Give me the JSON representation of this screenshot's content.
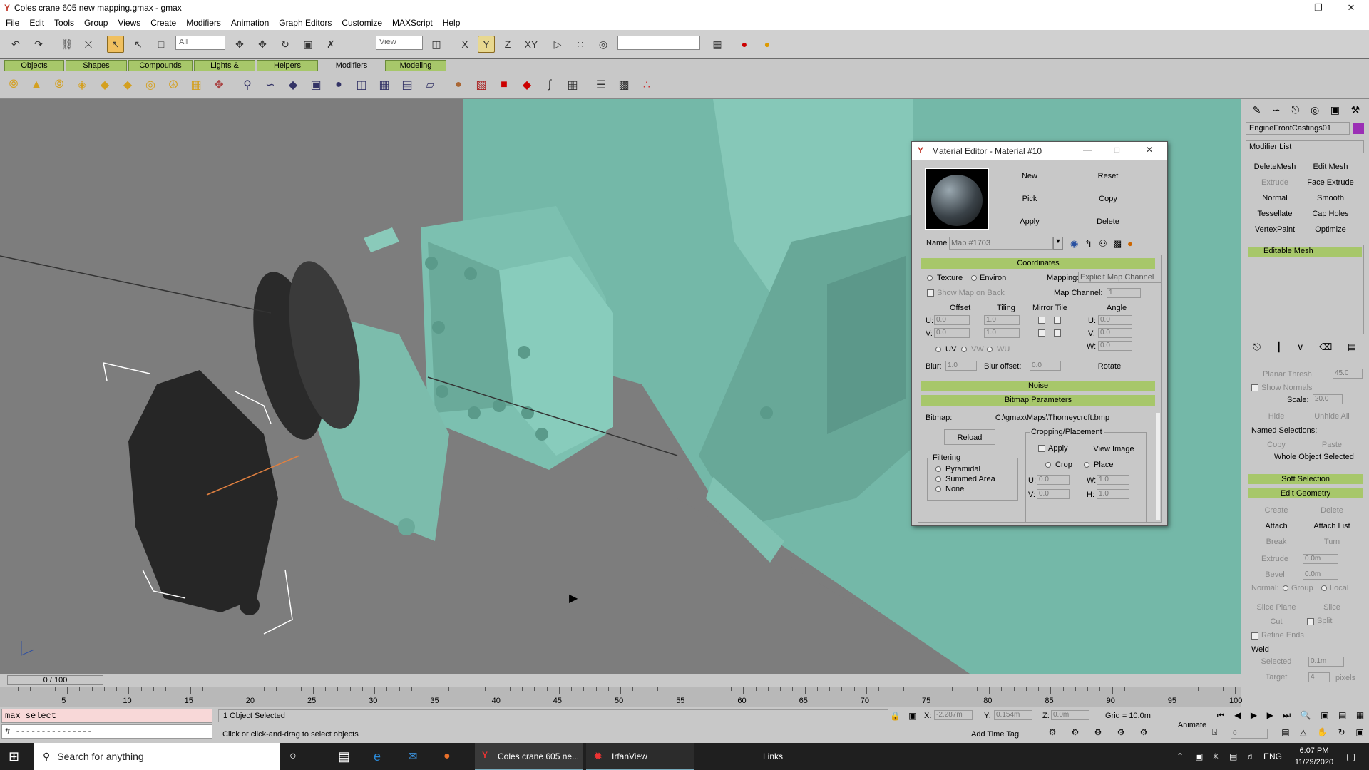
{
  "window": {
    "title": "Coles crane 605 new mapping.gmax - gmax"
  },
  "menu": [
    "File",
    "Edit",
    "Tools",
    "Group",
    "Views",
    "Create",
    "Modifiers",
    "Animation",
    "Graph Editors",
    "Customize",
    "MAXScript",
    "Help"
  ],
  "toolbar": {
    "selection_filter": "All",
    "ref_coord": "View",
    "axis_labels": [
      "X",
      "Y",
      "Z",
      "XY"
    ]
  },
  "tabs": [
    "Objects",
    "Shapes",
    "Compounds",
    "Lights & Cameras",
    "Helpers",
    "Modifiers",
    "Modeling"
  ],
  "active_tab": "Modifiers",
  "material_editor": {
    "title": "Material Editor - Material #10",
    "buttons": {
      "new": "New",
      "reset": "Reset",
      "pick": "Pick",
      "copy": "Copy",
      "apply": "Apply",
      "delete": "Delete"
    },
    "name_label": "Name",
    "name_value": "Map #1703",
    "coordinates": {
      "header": "Coordinates",
      "texture": "Texture",
      "environ": "Environ",
      "mapping_label": "Mapping:",
      "mapping_value": "Explicit Map Channel",
      "show_map_on_back": "Show Map on Back",
      "map_channel_label": "Map Channel:",
      "map_channel_value": "1",
      "offset": "Offset",
      "tiling": "Tiling",
      "mirror_tile": "Mirror Tile",
      "angle": "Angle",
      "u": "U:",
      "v": "V:",
      "w": "W:",
      "offset_u": "0.0",
      "offset_v": "0.0",
      "tiling_u": "1.0",
      "tiling_v": "1.0",
      "angle_u": "0.0",
      "angle_v": "0.0",
      "angle_w": "0.0",
      "uv": "UV",
      "vw": "VW",
      "wu": "WU",
      "blur_label": "Blur:",
      "blur_value": "1.0",
      "blur_offset_label": "Blur offset:",
      "blur_offset_value": "0.0",
      "rotate": "Rotate"
    },
    "noise": "Noise",
    "bitmap_params": {
      "header": "Bitmap Parameters",
      "bitmap_label": "Bitmap:",
      "bitmap_path": "C:\\gmax\\Maps\\Thorneycroft.bmp",
      "reload": "Reload",
      "cropping": "Cropping/Placement",
      "apply": "Apply",
      "view_image": "View Image",
      "crop": "Crop",
      "place": "Place",
      "u_val": "0.0",
      "v_val": "0.0",
      "w_val": "1.0",
      "h_val": "1.0",
      "w": "W:",
      "h": "H:",
      "filtering": "Filtering",
      "pyramidal": "Pyramidal",
      "summed_area": "Summed Area",
      "none": "None"
    }
  },
  "panel": {
    "object_name": "EngineFrontCastings01",
    "object_color": "#9b2fb5",
    "modifier_list": "Modifier List",
    "mod_buttons": [
      "DeleteMesh",
      "Edit Mesh",
      "Extrude",
      "Face Extrude",
      "Normal",
      "Smooth",
      "Tessellate",
      "Cap Holes",
      "VertexPaint",
      "Optimize"
    ],
    "stack_item": "Editable Mesh",
    "planar_thresh": "Planar Thresh",
    "planar_val": "45.0",
    "show_normals": "Show Normals",
    "scale_label": "Scale:",
    "scale_value": "20.0",
    "hide": "Hide",
    "unhide_all": "Unhide All",
    "named_selections": "Named Selections:",
    "copy": "Copy",
    "paste": "Paste",
    "whole_object": "Whole Object Selected",
    "soft_selection": "Soft Selection",
    "edit_geometry": "Edit Geometry",
    "create": "Create",
    "delete": "Delete",
    "attach": "Attach",
    "attach_list": "Attach List",
    "break": "Break",
    "turn": "Turn",
    "extrude": "Extrude",
    "extrude_val": "0.0m",
    "bevel": "Bevel",
    "bevel_val": "0.0m",
    "normal": "Normal:",
    "group": "Group",
    "local": "Local",
    "slice_plane": "Slice Plane",
    "slice": "Slice",
    "cut": "Cut",
    "split": "Split",
    "refine_ends": "Refine Ends",
    "weld": "Weld",
    "selected": "Selected",
    "selected_val": "0.1m",
    "target": "Target",
    "target_val": "4",
    "pixels": "pixels"
  },
  "timeline": {
    "frame": "0 / 100",
    "ticks": [
      "5",
      "10",
      "15",
      "20",
      "25",
      "30",
      "35",
      "40",
      "45",
      "50",
      "55",
      "60",
      "65",
      "70",
      "75",
      "80",
      "85",
      "90",
      "95",
      "100"
    ]
  },
  "status": {
    "listener_line1": "max select",
    "listener_line2": "# ---------------",
    "selected": "1 Object Selected",
    "prompt": "Click or click-and-drag to select objects",
    "x_label": "X:",
    "x_value": "-2.287m",
    "y_label": "Y:",
    "y_value": "0.154m",
    "z_label": "Z:",
    "z_value": "0.0m",
    "grid": "Grid = 10.0m",
    "add_time_tag": "Add Time Tag",
    "animate": "Animate",
    "frame_value": "0"
  },
  "taskbar": {
    "search": "Search for anything",
    "app1": "Coles crane 605 ne...",
    "app2": "IrfanView",
    "links": "Links",
    "lang": "ENG",
    "time": "6:07 PM",
    "date": "11/29/2020"
  }
}
